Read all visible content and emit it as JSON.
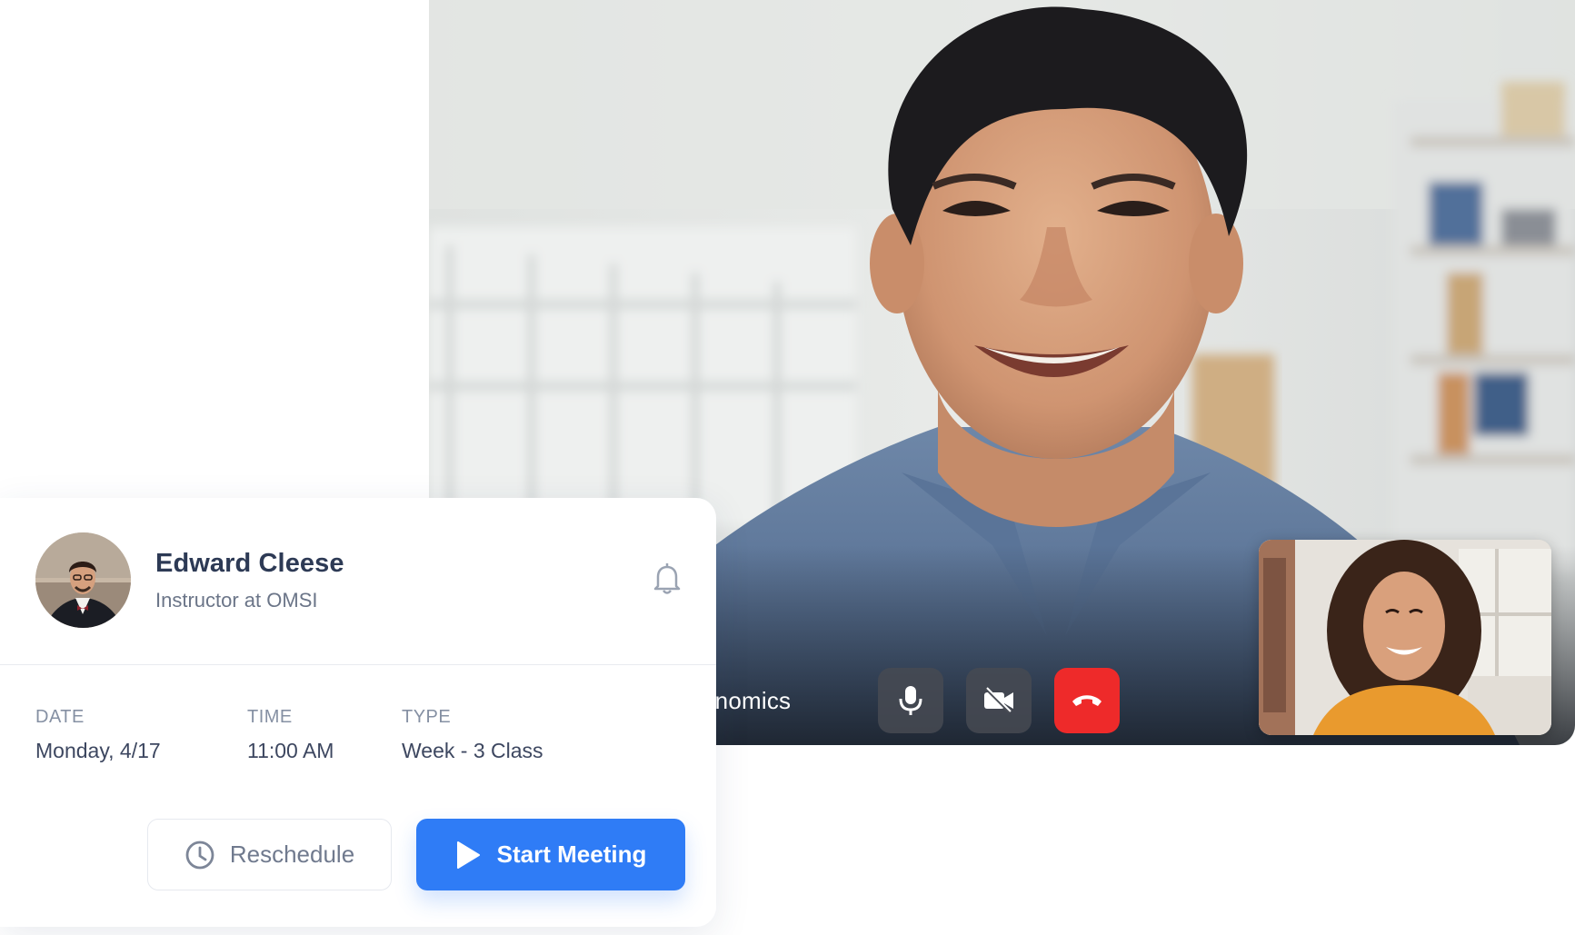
{
  "meeting": {
    "title_fragment": "onomics",
    "controls": {
      "mic_icon": "microphone-icon",
      "camera_icon": "video-off-icon",
      "end_icon": "phone-hangup-icon"
    }
  },
  "host": {
    "name": "Edward Cleese",
    "role": "Instructor at OMSI"
  },
  "details": {
    "date_label": "DATE",
    "date_value": "Monday, 4/17",
    "time_label": "TIME",
    "time_value": "11:00 AM",
    "type_label": "TYPE",
    "type_value": "Week - 3 Class"
  },
  "actions": {
    "reschedule_label": "Reschedule",
    "start_label": "Start Meeting"
  },
  "colors": {
    "primary": "#2f7cf6",
    "end_call": "#ee2a2a",
    "heading": "#2d3a55",
    "muted": "#6b7588"
  }
}
